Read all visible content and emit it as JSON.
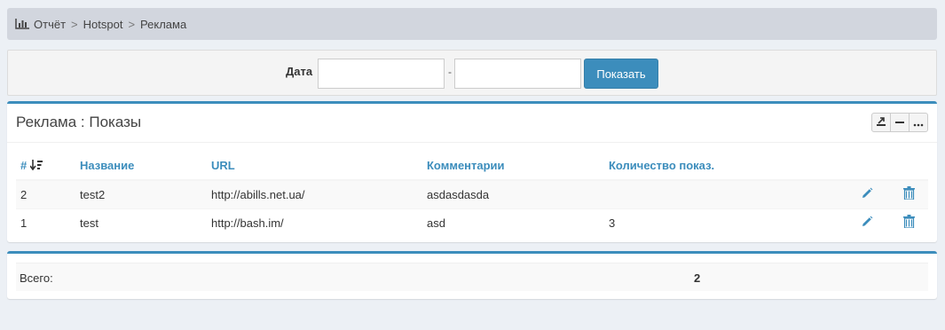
{
  "breadcrumb": {
    "items": [
      "Отчёт",
      "Hotspot",
      "Реклама"
    ],
    "icon": "bar-chart-icon"
  },
  "filter": {
    "label": "Дата",
    "from_value": "",
    "to_value": "",
    "separator": "-",
    "button_label": "Показать"
  },
  "box": {
    "title": "Реклама : Показы",
    "tools": [
      "export-icon",
      "minus-icon",
      "more-icon"
    ]
  },
  "table": {
    "columns": [
      "#",
      "Название",
      "URL",
      "Комментарии",
      "Количество показ."
    ],
    "rows": [
      {
        "id": "2",
        "name": "test2",
        "url": "http://abills.net.ua/",
        "comment": "asdasdasda",
        "count": ""
      },
      {
        "id": "1",
        "name": "test",
        "url": "http://bash.im/",
        "comment": "asd",
        "count": "3"
      }
    ]
  },
  "totals": {
    "label": "Всего:",
    "value": "2"
  },
  "colors": {
    "accent": "#3c8dbc",
    "background": "#ecf0f5",
    "breadcrumb_bg": "#d2d6de"
  }
}
